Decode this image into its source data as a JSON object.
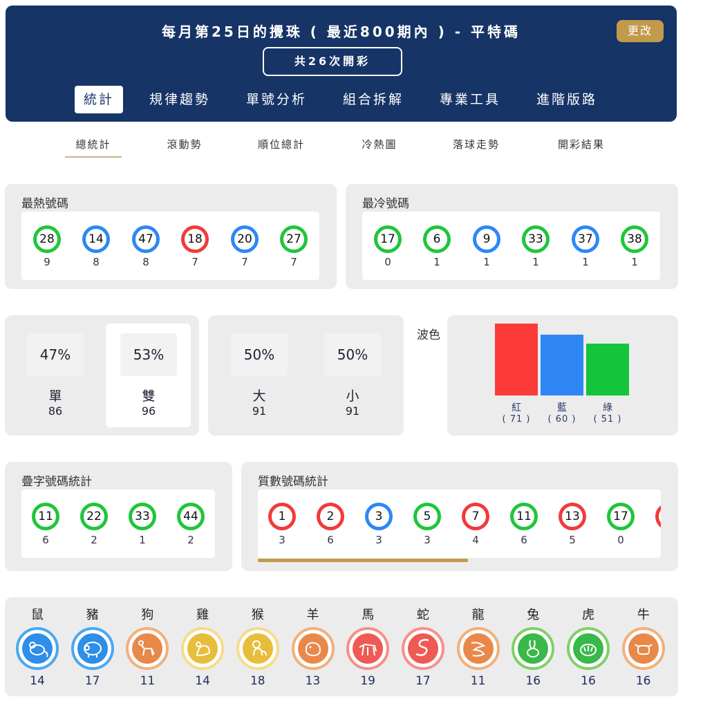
{
  "header": {
    "title": "每月第25日的攪珠 ( 最近800期內 ) - 平特碼",
    "change_label": "更改",
    "count_label": "共26次開彩",
    "tabs": [
      {
        "label": "統計"
      },
      {
        "label": "規律趨勢"
      },
      {
        "label": "單號分析"
      },
      {
        "label": "組合拆解"
      },
      {
        "label": "專業工具"
      },
      {
        "label": "進階版路"
      }
    ]
  },
  "subnav": [
    {
      "label": "總統計"
    },
    {
      "label": "滾動勢"
    },
    {
      "label": "順位總計"
    },
    {
      "label": "冷熱圖"
    },
    {
      "label": "落球走勢"
    },
    {
      "label": "開彩結果"
    }
  ],
  "hot": {
    "title": "最熱號碼",
    "balls": [
      {
        "num": "28",
        "color": "green",
        "count": "9"
      },
      {
        "num": "14",
        "color": "blue",
        "count": "8"
      },
      {
        "num": "47",
        "color": "blue",
        "count": "8"
      },
      {
        "num": "18",
        "color": "red",
        "count": "7"
      },
      {
        "num": "20",
        "color": "blue",
        "count": "7"
      },
      {
        "num": "27",
        "color": "green",
        "count": "7"
      }
    ]
  },
  "cold": {
    "title": "最冷號碼",
    "balls": [
      {
        "num": "17",
        "color": "green",
        "count": "0"
      },
      {
        "num": "6",
        "color": "green",
        "count": "1"
      },
      {
        "num": "9",
        "color": "blue",
        "count": "1"
      },
      {
        "num": "33",
        "color": "green",
        "count": "1"
      },
      {
        "num": "37",
        "color": "blue",
        "count": "1"
      },
      {
        "num": "38",
        "color": "green",
        "count": "1"
      }
    ]
  },
  "odd_even": {
    "odd": {
      "pct": "47%",
      "label": "單",
      "count": "86"
    },
    "even": {
      "pct": "53%",
      "label": "雙",
      "count": "96"
    }
  },
  "big_small": {
    "big": {
      "pct": "50%",
      "label": "大",
      "count": "91"
    },
    "small": {
      "pct": "50%",
      "label": "小",
      "count": "91"
    }
  },
  "wave": {
    "title": "波色",
    "bars": [
      {
        "label": "紅",
        "value": 71,
        "display": "( 71 )",
        "color": "#fc3a3a"
      },
      {
        "label": "藍",
        "value": 60,
        "display": "( 60 )",
        "color": "#2e87f5"
      },
      {
        "label": "綠",
        "value": 51,
        "display": "( 51 )",
        "color": "#14c43a"
      }
    ]
  },
  "repeat": {
    "title": "疊字號碼統計",
    "balls": [
      {
        "num": "11",
        "color": "green",
        "count": "6"
      },
      {
        "num": "22",
        "color": "green",
        "count": "2"
      },
      {
        "num": "33",
        "color": "green",
        "count": "1"
      },
      {
        "num": "44",
        "color": "green",
        "count": "2"
      }
    ]
  },
  "prime": {
    "title": "質數號碼統計",
    "balls": [
      {
        "num": "1",
        "color": "red",
        "count": "3"
      },
      {
        "num": "2",
        "color": "red",
        "count": "6"
      },
      {
        "num": "3",
        "color": "blue",
        "count": "3"
      },
      {
        "num": "5",
        "color": "green",
        "count": "3"
      },
      {
        "num": "7",
        "color": "red",
        "count": "4"
      },
      {
        "num": "11",
        "color": "green",
        "count": "6"
      },
      {
        "num": "13",
        "color": "red",
        "count": "5"
      },
      {
        "num": "17",
        "color": "green",
        "count": "0"
      }
    ]
  },
  "zodiac": [
    {
      "name": "鼠",
      "count": "14",
      "ring": "#4aa8f0",
      "fill": "#2e8ee8",
      "icon": "rat-icon"
    },
    {
      "name": "豬",
      "count": "17",
      "ring": "#4aa8f0",
      "fill": "#2e8ee8",
      "icon": "pig-icon"
    },
    {
      "name": "狗",
      "count": "11",
      "ring": "#f2b07a",
      "fill": "#e8894a",
      "icon": "dog-icon"
    },
    {
      "name": "雞",
      "count": "14",
      "ring": "#f5dc8a",
      "fill": "#e7bd3c",
      "icon": "rooster-icon"
    },
    {
      "name": "猴",
      "count": "18",
      "ring": "#f5dc8a",
      "fill": "#e7bd3c",
      "icon": "monkey-icon"
    },
    {
      "name": "羊",
      "count": "13",
      "ring": "#f2b07a",
      "fill": "#e8894a",
      "icon": "goat-icon"
    },
    {
      "name": "馬",
      "count": "19",
      "ring": "#f6908a",
      "fill": "#ef5a55",
      "icon": "horse-icon"
    },
    {
      "name": "蛇",
      "count": "17",
      "ring": "#f6908a",
      "fill": "#ef5a55",
      "icon": "snake-icon"
    },
    {
      "name": "龍",
      "count": "11",
      "ring": "#f2b07a",
      "fill": "#e8894a",
      "icon": "dragon-icon"
    },
    {
      "name": "兔",
      "count": "16",
      "ring": "#7fd06a",
      "fill": "#3ab84a",
      "icon": "rabbit-icon"
    },
    {
      "name": "虎",
      "count": "16",
      "ring": "#7fd06a",
      "fill": "#3ab84a",
      "icon": "tiger-icon"
    },
    {
      "name": "牛",
      "count": "16",
      "ring": "#f2b07a",
      "fill": "#e8894a",
      "icon": "ox-icon"
    }
  ]
}
